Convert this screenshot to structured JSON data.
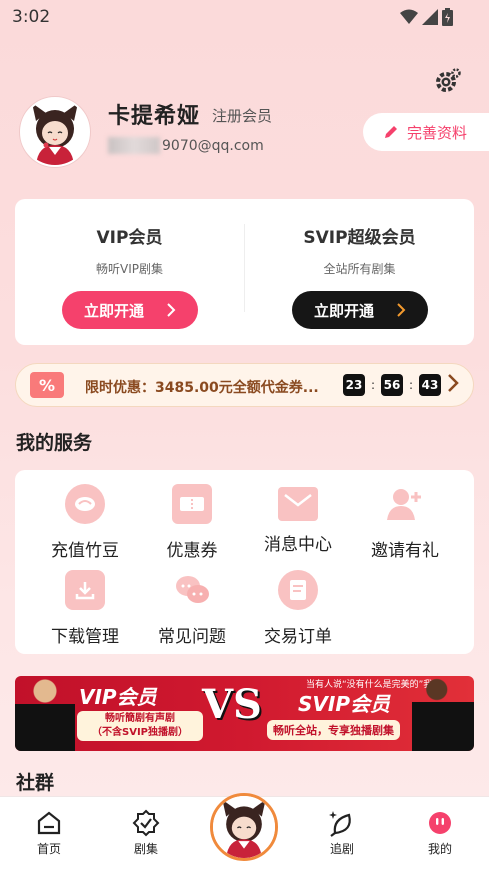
{
  "status_bar": {
    "time": "3:02"
  },
  "profile": {
    "name": "卡提希娅",
    "member_tag": "注册会员",
    "email_visible": "9070@qq.com",
    "edit_label": "完善资料"
  },
  "vip": {
    "vip_title": "VIP会员",
    "vip_sub": "畅听VIP剧集",
    "vip_button": "立即开通",
    "svip_title": "SVIP超级会员",
    "svip_sub": "全站所有剧集",
    "svip_button": "立即开通"
  },
  "promo": {
    "text": "限时优惠：3485.00元全额代金券...",
    "hours": "23",
    "minutes": "56",
    "seconds": "43",
    "sep": ":"
  },
  "services": {
    "title": "我的服务",
    "items": [
      {
        "label": "充值竹豆",
        "icon": "bean-icon"
      },
      {
        "label": "优惠券",
        "icon": "coupon-icon"
      },
      {
        "label": "消息中心",
        "icon": "mail-icon"
      },
      {
        "label": "邀请有礼",
        "icon": "invite-user-icon"
      },
      {
        "label": "下载管理",
        "icon": "download-icon"
      },
      {
        "label": "常见问题",
        "icon": "chat-bubbles-icon"
      },
      {
        "label": "交易订单",
        "icon": "order-doc-icon"
      }
    ]
  },
  "banner": {
    "left_title": "VIP会员",
    "left_sub_1": "畅听簡剧有声剧",
    "left_sub_2": "（不含SVIP独播剧）",
    "vs": "VS",
    "quote": "当有人说“没有什么是完美的”我：",
    "right_title": "SVIP会员",
    "right_sub": "畅听全站，专享独播剧集"
  },
  "community": {
    "title": "社群"
  },
  "tabbar": {
    "items": [
      {
        "label": "首页",
        "icon": "home-icon"
      },
      {
        "label": "剧集",
        "icon": "badge-check-icon"
      },
      {
        "label": "追剧",
        "icon": "sparkle-leaf-icon"
      },
      {
        "label": "我的",
        "icon": "profile-pill-icon"
      }
    ]
  },
  "colors": {
    "accent": "#f5416c",
    "svip_arrow": "#f39a2e",
    "promo_text": "#8a4a20"
  }
}
